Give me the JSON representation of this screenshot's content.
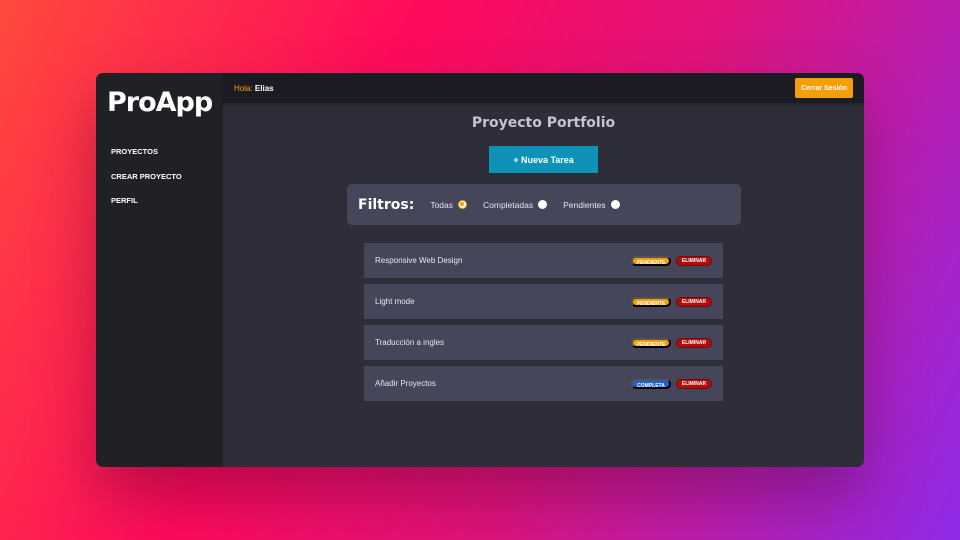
{
  "app": {
    "logo": "ProApp"
  },
  "sidebar": {
    "items": [
      {
        "label": "Proyectos"
      },
      {
        "label": "Crear Proyecto"
      },
      {
        "label": "Perfil"
      }
    ]
  },
  "topbar": {
    "greeting": "Hola:",
    "user": "Elias",
    "logout_label": "Cerrar Sesión"
  },
  "project": {
    "title": "Proyecto Portfolio",
    "new_task_label": "+ Nueva Tarea"
  },
  "filters": {
    "label": "Filtros:",
    "options": [
      {
        "label": "Todas",
        "checked": true
      },
      {
        "label": "Completadas",
        "checked": false
      },
      {
        "label": "Pendientes",
        "checked": false
      }
    ]
  },
  "tasks": [
    {
      "name": "Responsive Web Design",
      "status": "Pendiente",
      "delete_label": "Eliminar"
    },
    {
      "name": "Light mode",
      "status": "Pendiente",
      "delete_label": "Eliminar"
    },
    {
      "name": "Traducción a ingles",
      "status": "Pendiente",
      "delete_label": "Eliminar"
    },
    {
      "name": "Añadir Proyectos",
      "status": "Completa",
      "delete_label": "Eliminar"
    }
  ],
  "colors": {
    "accent": "#f59e0b",
    "primary_button": "#0e92b8",
    "complete": "#1d63d6",
    "danger": "#b00d0d"
  }
}
